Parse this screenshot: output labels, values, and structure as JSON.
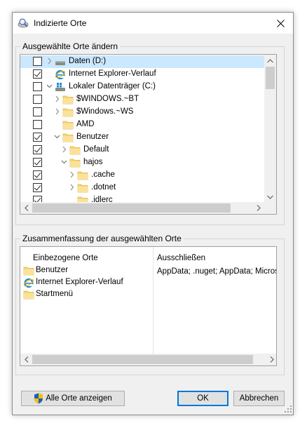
{
  "window": {
    "title": "Indizierte Orte",
    "close_icon": "close-icon"
  },
  "group_change": {
    "label": "Ausgewählte Orte ändern",
    "tree": [
      {
        "label": "Daten (D:)",
        "checked": false,
        "expander": "collapsed",
        "icon": "drive-icon",
        "level": 0,
        "selected": true
      },
      {
        "label": "Internet Explorer-Verlauf",
        "checked": true,
        "expander": "none",
        "icon": "ie-icon",
        "level": 0,
        "selected": false
      },
      {
        "label": "Lokaler Datenträger (C:)",
        "checked": false,
        "expander": "expanded",
        "icon": "windows-drive-icon",
        "level": 0,
        "selected": false
      },
      {
        "label": "$WINDOWS.~BT",
        "checked": false,
        "expander": "collapsed",
        "icon": "folder-icon",
        "level": 1,
        "selected": false
      },
      {
        "label": "$Windows.~WS",
        "checked": false,
        "expander": "collapsed",
        "icon": "folder-icon",
        "level": 1,
        "selected": false
      },
      {
        "label": "AMD",
        "checked": false,
        "expander": "none",
        "icon": "folder-icon",
        "level": 1,
        "selected": false
      },
      {
        "label": "Benutzer",
        "checked": true,
        "expander": "expanded",
        "icon": "folder-icon",
        "level": 1,
        "selected": false
      },
      {
        "label": "Default",
        "checked": true,
        "expander": "collapsed",
        "icon": "folder-icon",
        "level": 2,
        "selected": false
      },
      {
        "label": "hajos",
        "checked": true,
        "expander": "expanded",
        "icon": "folder-icon",
        "level": 2,
        "selected": false
      },
      {
        "label": ".cache",
        "checked": true,
        "expander": "collapsed",
        "icon": "folder-icon",
        "level": 3,
        "selected": false
      },
      {
        "label": ".dotnet",
        "checked": true,
        "expander": "collapsed",
        "icon": "folder-icon",
        "level": 3,
        "selected": false
      },
      {
        "label": ".idlerc",
        "checked": true,
        "expander": "none",
        "icon": "folder-icon",
        "level": 3,
        "selected": false
      }
    ]
  },
  "group_summary": {
    "label": "Zusammenfassung der ausgewählten Orte",
    "included_header": "Einbezogene Orte",
    "excluded_header": "Ausschließen",
    "included": [
      {
        "label": "Benutzer",
        "icon": "folder-icon"
      },
      {
        "label": "Internet Explorer-Verlauf",
        "icon": "ie-icon"
      },
      {
        "label": "Startmenü",
        "icon": "folder-icon"
      }
    ],
    "excluded_text": "AppData; .nuget; AppData; Micros"
  },
  "buttons": {
    "show_all": "Alle Orte anzeigen",
    "ok": "OK",
    "cancel": "Abbrechen"
  },
  "colors": {
    "selection": "#cce8ff",
    "folder": "#f8d775",
    "default_button_border": "#0078d7"
  }
}
